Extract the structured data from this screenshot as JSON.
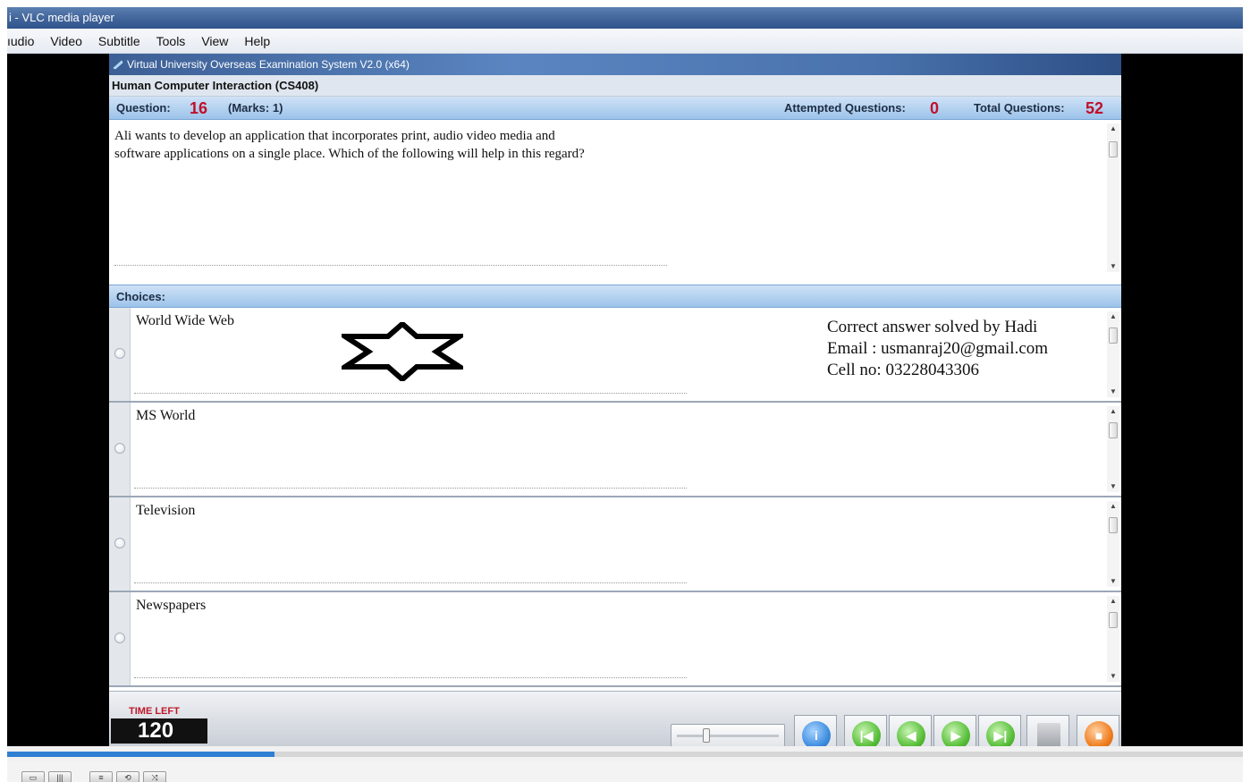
{
  "vlc": {
    "title": "i - VLC media player",
    "menu": [
      "ıudio",
      "Video",
      "Subtitle",
      "Tools",
      "View",
      "Help"
    ],
    "seek_progress_fraction": 0.216
  },
  "exam": {
    "window_title": "Virtual University Overseas Examination System  V2.0 (x64)",
    "course": "Human Computer Interaction  (CS408)",
    "question_label": "Question:",
    "question_number": "16",
    "marks": "(Marks: 1)",
    "attempted_label": "Attempted Questions:",
    "attempted_value": "0",
    "total_label": "Total Questions:",
    "total_value": "52",
    "question_text_line1": "Ali wants to develop an application that incorporates print, audio video media and",
    "question_text_line2": "software applications on a single place. Which of the following will help in this regard?",
    "choices_label": "Choices:",
    "choices": [
      {
        "label": "World Wide Web"
      },
      {
        "label": "MS World"
      },
      {
        "label": "Television"
      },
      {
        "label": "Newspapers"
      }
    ],
    "watermark": {
      "line1": "Correct answer solved by Hadi",
      "line2": "Email : usmanraj20@gmail.com",
      "line3": "Cell no: 03228043306"
    },
    "time_left_label": "TIME LEFT",
    "time_left_value": "120",
    "volume_level_fraction": 0.27,
    "colors": {
      "info": "#3f8ee0",
      "nav_green": "#59c03a",
      "finish_orange": "#f07e1f"
    }
  }
}
